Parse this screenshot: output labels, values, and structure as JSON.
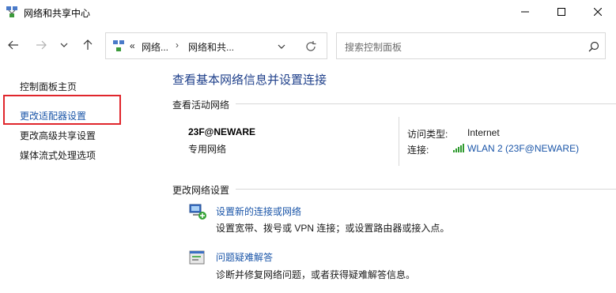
{
  "window": {
    "title": "网络和共享中心",
    "icon": "network-center-icon"
  },
  "nav": {
    "breadcrumb": [
      "«",
      "网络...",
      "网络和共..."
    ],
    "search_placeholder": "搜索控制面板"
  },
  "sidebar": {
    "items": [
      {
        "label": "控制面板主页",
        "active": false
      },
      {
        "label": "更改适配器设置",
        "active": true
      },
      {
        "label": "更改高级共享设置",
        "active": false
      },
      {
        "label": "媒体流式处理选项",
        "active": false
      }
    ],
    "highlight_color": "#e0262c"
  },
  "main": {
    "title": "查看基本网络信息并设置连接",
    "active_networks_label": "查看活动网络",
    "network": {
      "name": "23F@NEWARE",
      "type": "专用网络",
      "access_type_label": "访问类型:",
      "access_type_value": "Internet",
      "connection_label": "连接:",
      "connection_value": "WLAN 2 (23F@NEWARE)"
    },
    "change_settings_label": "更改网络设置",
    "tasks": [
      {
        "link": "设置新的连接或网络",
        "desc": "设置宽带、拨号或 VPN 连接；或设置路由器或接入点。",
        "icon": "new-connection-icon"
      },
      {
        "link": "问题疑难解答",
        "desc": "诊断并修复网络问题，或者获得疑难解答信息。",
        "icon": "troubleshoot-icon"
      }
    ]
  },
  "colors": {
    "link": "#1a55a8",
    "title": "#1e3f8a"
  }
}
